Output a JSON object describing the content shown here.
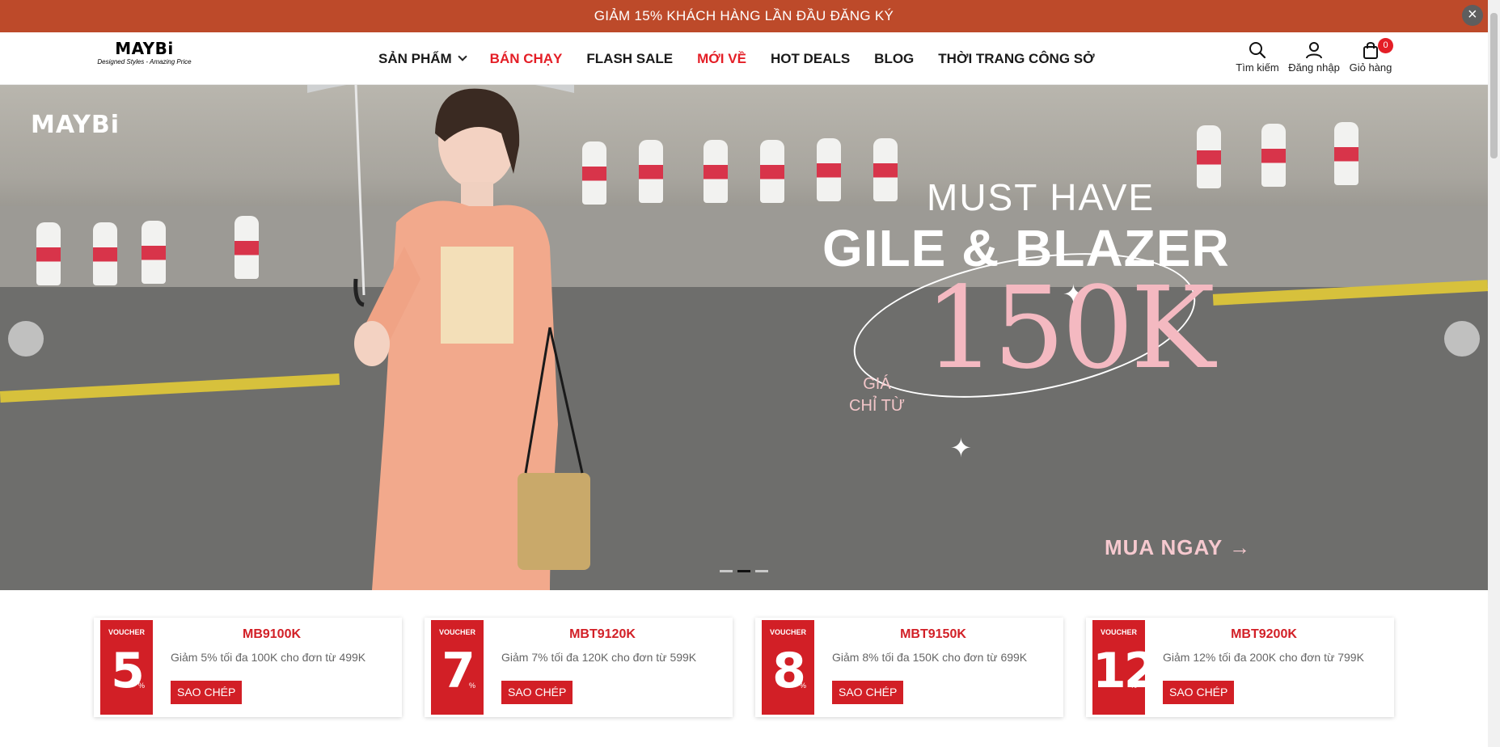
{
  "announcement": {
    "text": "GIẢM 15% KHÁCH HÀNG LẦN ĐẦU ĐĂNG KÝ",
    "close": "×"
  },
  "header": {
    "logo": {
      "name": "MAYBi",
      "tagline": "Designed Styles - Amazing Price"
    },
    "nav": [
      {
        "label": "SẢN PHẨM",
        "highlight": false,
        "has_dropdown": true
      },
      {
        "label": "BÁN CHẠY",
        "highlight": true
      },
      {
        "label": "FLASH SALE",
        "highlight": false
      },
      {
        "label": "MỚI VỀ",
        "highlight": true
      },
      {
        "label": "HOT DEALS",
        "highlight": false
      },
      {
        "label": "BLOG",
        "highlight": false
      },
      {
        "label": "THỜI TRANG CÔNG SỞ",
        "highlight": false
      }
    ],
    "actions": {
      "search": "Tìm kiếm",
      "login": "Đăng nhập",
      "cart": "Giỏ hàng",
      "cart_count": "0"
    }
  },
  "hero": {
    "logo": "MAYBi",
    "headline_1": "MUST HAVE",
    "headline_2": "GILE & BLAZER",
    "price_prefix_1": "GIÁ",
    "price_prefix_2": "CHỈ TỪ",
    "price": "150K",
    "cta": "MUA NGAY →",
    "slides": 3,
    "active_slide": 2
  },
  "vouchers": [
    {
      "tag": "VOUCHER",
      "percent": "5",
      "pct_sign": "%",
      "code": "MB9100K",
      "desc": "Giảm 5% tối đa 100K cho đơn từ 499K",
      "copy": "SAO CHÉP"
    },
    {
      "tag": "VOUCHER",
      "percent": "7",
      "pct_sign": "%",
      "code": "MBT9120K",
      "desc": "Giảm 7% tối đa 120K cho đơn từ 599K",
      "copy": "SAO CHÉP"
    },
    {
      "tag": "VOUCHER",
      "percent": "8",
      "pct_sign": "%",
      "code": "MBT9150K",
      "desc": "Giảm 8% tối đa 150K cho đơn từ 699K",
      "copy": "SAO CHÉP"
    },
    {
      "tag": "VOUCHER",
      "percent": "12",
      "pct_sign": "%",
      "code": "MBT9200K",
      "desc": "Giảm 12% tối đa 200K cho đơn từ 799K",
      "copy": "SAO CHÉP"
    }
  ],
  "colors": {
    "topbar": "#bd4a2a",
    "accent_red": "#e41e26",
    "voucher_red": "#d21f26",
    "price_pink": "#f4b9c1"
  }
}
